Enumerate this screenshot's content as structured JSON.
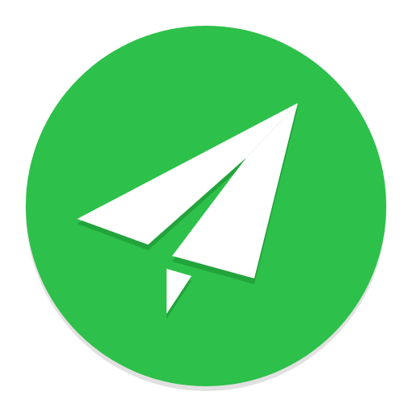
{
  "icon": {
    "name": "paper-plane-icon",
    "colors": {
      "badge": "#2dc04a",
      "badge_highlight": "#5bd16f",
      "badge_shadow": "#c8c8c8",
      "glyph": "#ffffff",
      "glyph_shadow": "#1f9a37"
    }
  }
}
